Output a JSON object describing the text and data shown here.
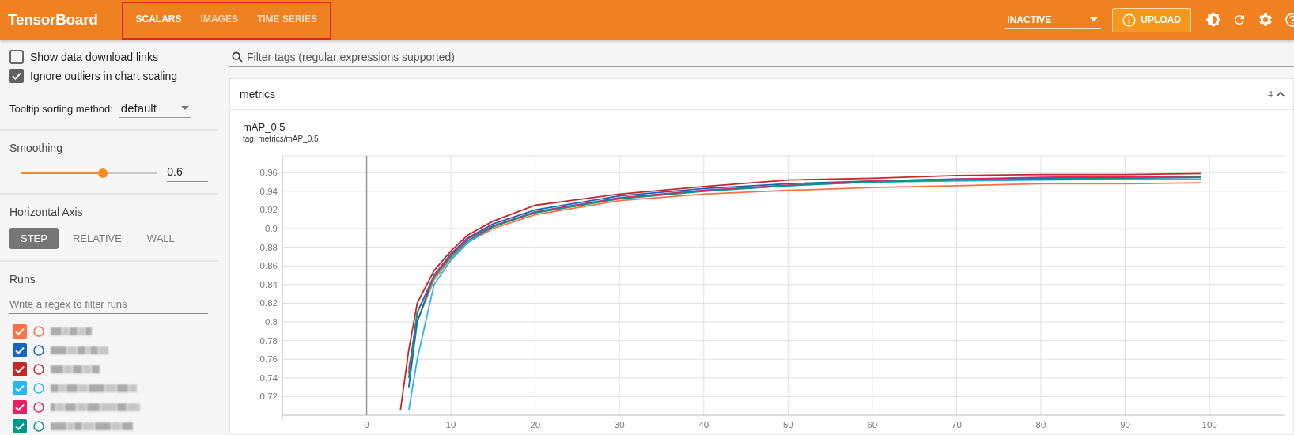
{
  "header": {
    "title": "TensorBoard",
    "tabs": [
      {
        "label": "SCALARS",
        "selected": true
      },
      {
        "label": "IMAGES",
        "selected": false
      },
      {
        "label": "TIME SERIES",
        "selected": false
      }
    ],
    "run_selector": {
      "value": "INACTIVE"
    },
    "upload_button": {
      "label": "UPLOAD"
    }
  },
  "sidebar": {
    "options": [
      {
        "label": "Show data download links",
        "checked": false
      },
      {
        "label": "Ignore outliers in chart scaling",
        "checked": true
      }
    ],
    "tooltip_sorting": {
      "label": "Tooltip sorting method:",
      "value": "default"
    },
    "smoothing": {
      "label": "Smoothing",
      "level": 0.6,
      "reading": "0.6"
    },
    "horizontal_axis": {
      "label": "Horizontal Axis",
      "options": [
        {
          "label": "STEP",
          "selected": true
        },
        {
          "label": "RELATIVE",
          "selected": false
        },
        {
          "label": "WALL",
          "selected": false
        }
      ]
    },
    "runs": {
      "label": "Runs",
      "filter_placeholder": "Write a regex to filter runs",
      "items": [
        {
          "checked": true,
          "color": "#ff7043"
        },
        {
          "checked": true,
          "color": "#1565c0"
        },
        {
          "checked": true,
          "color": "#c62828"
        },
        {
          "checked": true,
          "color": "#29b6f6"
        },
        {
          "checked": true,
          "color": "#e91e63"
        },
        {
          "checked": true,
          "color": "#009688"
        }
      ]
    }
  },
  "main": {
    "filter": {
      "placeholder": "Filter tags (regular expressions supported)"
    },
    "group": {
      "name": "metrics",
      "count": "4",
      "expanded": true,
      "card": {
        "title": "mAP_0.5",
        "tag": "tag: metrics/mAP_0.5",
        "chart_data": {
          "type": "line",
          "grid": true,
          "x": [
            4,
            5,
            6,
            8,
            10,
            12,
            15,
            20,
            30,
            40,
            50,
            60,
            70,
            80,
            90,
            99
          ],
          "xlim": [
            -10,
            109
          ],
          "ylim": [
            0.7,
            0.978
          ],
          "xticks": [
            0,
            10,
            20,
            30,
            40,
            50,
            60,
            70,
            80,
            90,
            100
          ],
          "yticks": [
            0.72,
            0.74,
            0.76,
            0.78,
            0.8,
            0.82,
            0.84,
            0.86,
            0.88,
            0.9,
            0.92,
            0.94,
            0.96
          ],
          "series": [
            {
              "color": "#ff7043",
              "values": [
                null,
                0.75,
                0.8,
                0.845,
                0.868,
                0.885,
                0.9,
                0.915,
                0.93,
                0.937,
                0.941,
                0.944,
                0.946,
                0.948,
                0.948,
                0.949
              ]
            },
            {
              "color": "#1565c0",
              "values": [
                null,
                0.73,
                0.8,
                0.85,
                0.873,
                0.89,
                0.905,
                0.92,
                0.935,
                0.943,
                0.948,
                0.951,
                0.953,
                0.954,
                0.955,
                0.956
              ]
            },
            {
              "color": "#c62828",
              "values": [
                0.705,
                0.77,
                0.82,
                0.855,
                0.876,
                0.893,
                0.908,
                0.925,
                0.937,
                0.945,
                0.952,
                0.954,
                0.957,
                0.958,
                0.958,
                0.959
              ]
            },
            {
              "color": "#29b6f6",
              "values": [
                null,
                0.705,
                0.76,
                0.84,
                0.866,
                0.885,
                0.902,
                0.918,
                0.933,
                0.941,
                0.946,
                0.95,
                0.951,
                0.952,
                0.953,
                0.953
              ]
            },
            {
              "color": "#e91e63",
              "values": [
                null,
                0.745,
                0.81,
                0.85,
                0.872,
                0.889,
                0.903,
                0.918,
                0.933,
                0.941,
                0.9465,
                0.951,
                0.953,
                0.955,
                0.956,
                0.956
              ]
            },
            {
              "color": "#009688",
              "values": [
                null,
                0.74,
                0.81,
                0.848,
                0.87,
                0.887,
                0.902,
                0.917,
                0.932,
                0.94,
                0.946,
                0.95,
                0.952,
                0.953,
                0.954,
                0.955
              ]
            }
          ]
        }
      }
    }
  }
}
